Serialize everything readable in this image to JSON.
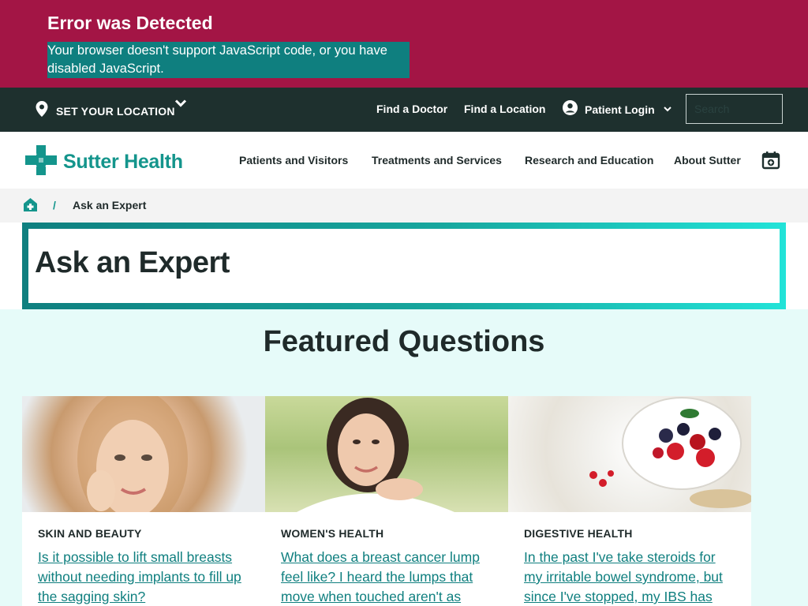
{
  "error": {
    "title": "Error was Detected",
    "message": "Your browser doesn't support JavaScript code, or you have disabled JavaScript."
  },
  "utility": {
    "location_label": "SET YOUR LOCATION",
    "find_doctor": "Find a Doctor",
    "find_location": "Find a Location",
    "patient_login": "Patient Login",
    "search_placeholder": "Search"
  },
  "brand": {
    "name": "Sutter Health",
    "accent": "#14958c",
    "banner_color": "#a31545",
    "dark_bar": "#1e302e"
  },
  "nav": {
    "items": [
      {
        "label": "Patients and Visitors"
      },
      {
        "label": "Treatments and Services"
      },
      {
        "label": "Research and Education"
      },
      {
        "label": "About Sutter"
      }
    ]
  },
  "breadcrumb": {
    "separator": "/",
    "current": "Ask an Expert"
  },
  "page": {
    "title": "Ask an Expert"
  },
  "featured": {
    "title": "Featured Questions",
    "cards": [
      {
        "category": "SKIN AND BEAUTY",
        "question": "Is it possible to lift small breasts without needing implants to fill up the sagging skin?",
        "image": "woman-portrait-photo"
      },
      {
        "category": "WOMEN'S HEALTH",
        "question": "What does a breast cancer lump feel like? I heard the lumps that move when touched aren't as",
        "image": "smiling-woman-outdoors-photo"
      },
      {
        "category": "DIGESTIVE HEALTH",
        "question": "In the past I've take steroids for my irritable bowel syndrome, but since I've stopped, my IBS has",
        "image": "yogurt-berries-bowl-photo"
      }
    ]
  }
}
